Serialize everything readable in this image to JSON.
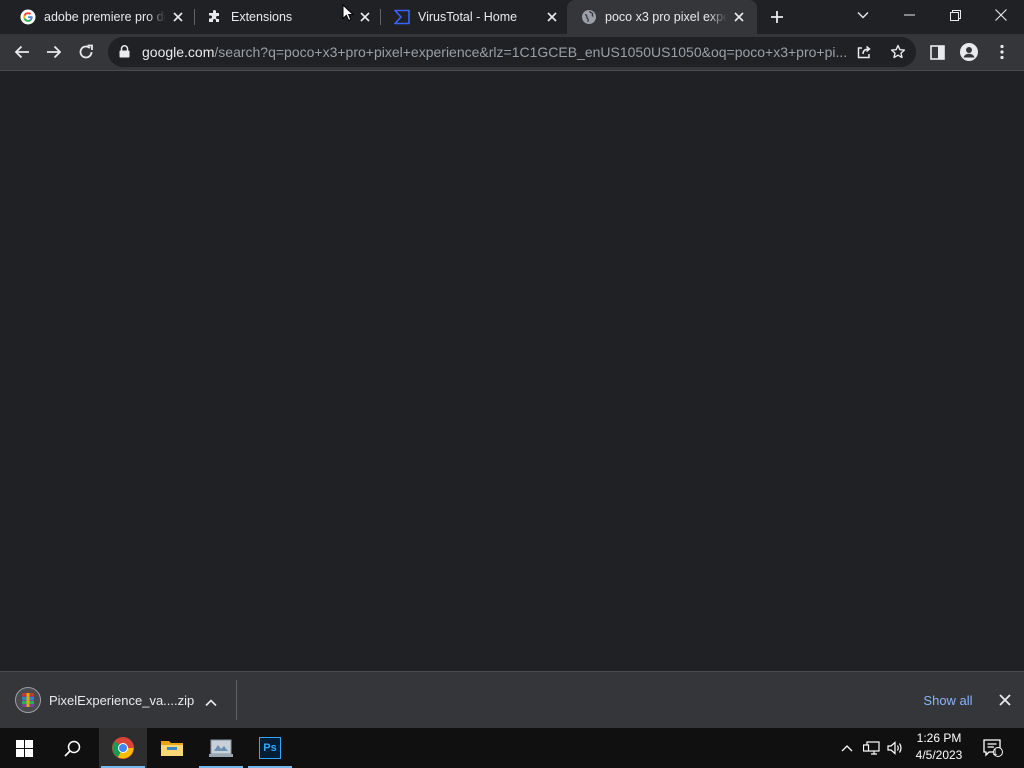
{
  "tabs": [
    {
      "title": "adobe premiere pro do",
      "icon": "google-g-icon",
      "active": false
    },
    {
      "title": "Extensions",
      "icon": "puzzle-piece-icon",
      "active": false
    },
    {
      "title": "VirusTotal - Home",
      "icon": "virustotal-icon",
      "active": false
    },
    {
      "title": "poco x3 pro pixel expe",
      "icon": "globe-icon",
      "active": true
    }
  ],
  "address_bar": {
    "host": "google.com",
    "path": "/search?q=poco+x3+pro+pixel+experience&rlz=1C1GCEB_enUS1050US1050&oq=poco+x3+pro+pi..."
  },
  "downloads": {
    "file_name": "PixelExperience_va....zip",
    "show_all_label": "Show all"
  },
  "taskbar": {
    "apps": [
      "start-icon",
      "search-icon",
      "chrome-icon",
      "file-explorer-icon",
      "scanner-app-icon",
      "photoshop-icon"
    ],
    "photoshop_label": "Ps",
    "clock_time": "1:26 PM",
    "clock_date": "4/5/2023",
    "notification_count": "1"
  },
  "colors": {
    "frame": "#202124",
    "toolbar": "#35363a",
    "link": "#8ab4f8",
    "text": "#e8eaed",
    "taskbar": "#101010",
    "taskbar_accent": "#76b9ed"
  }
}
